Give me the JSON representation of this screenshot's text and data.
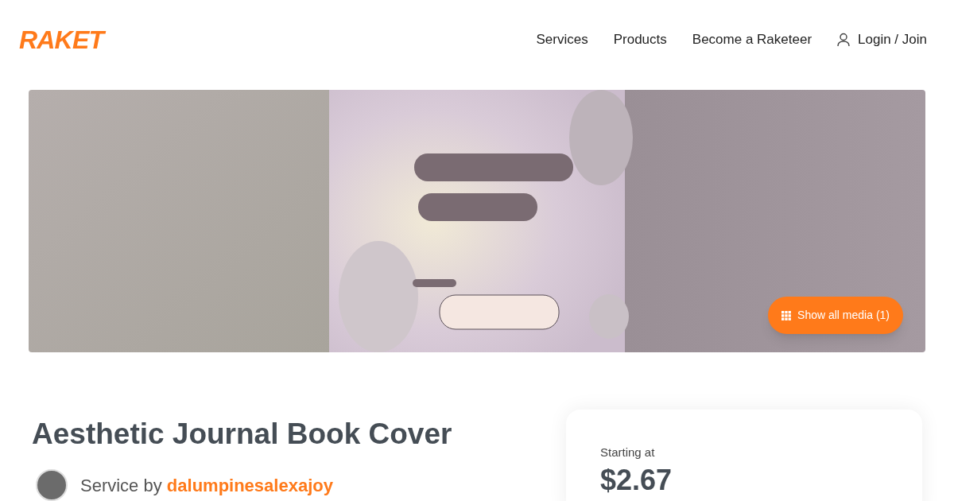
{
  "header": {
    "logo": "RAKET",
    "nav": [
      "Services",
      "Products",
      "Become a Raketeer"
    ],
    "login": "Login / Join"
  },
  "banner": {
    "show_all_button": "Show all media (1)"
  },
  "service": {
    "title": "Aesthetic Journal Book Cover",
    "by_label": "Service by",
    "provider": "dalumpinesalexajoy"
  },
  "price_card": {
    "label": "Starting at",
    "price": "$2.67"
  }
}
